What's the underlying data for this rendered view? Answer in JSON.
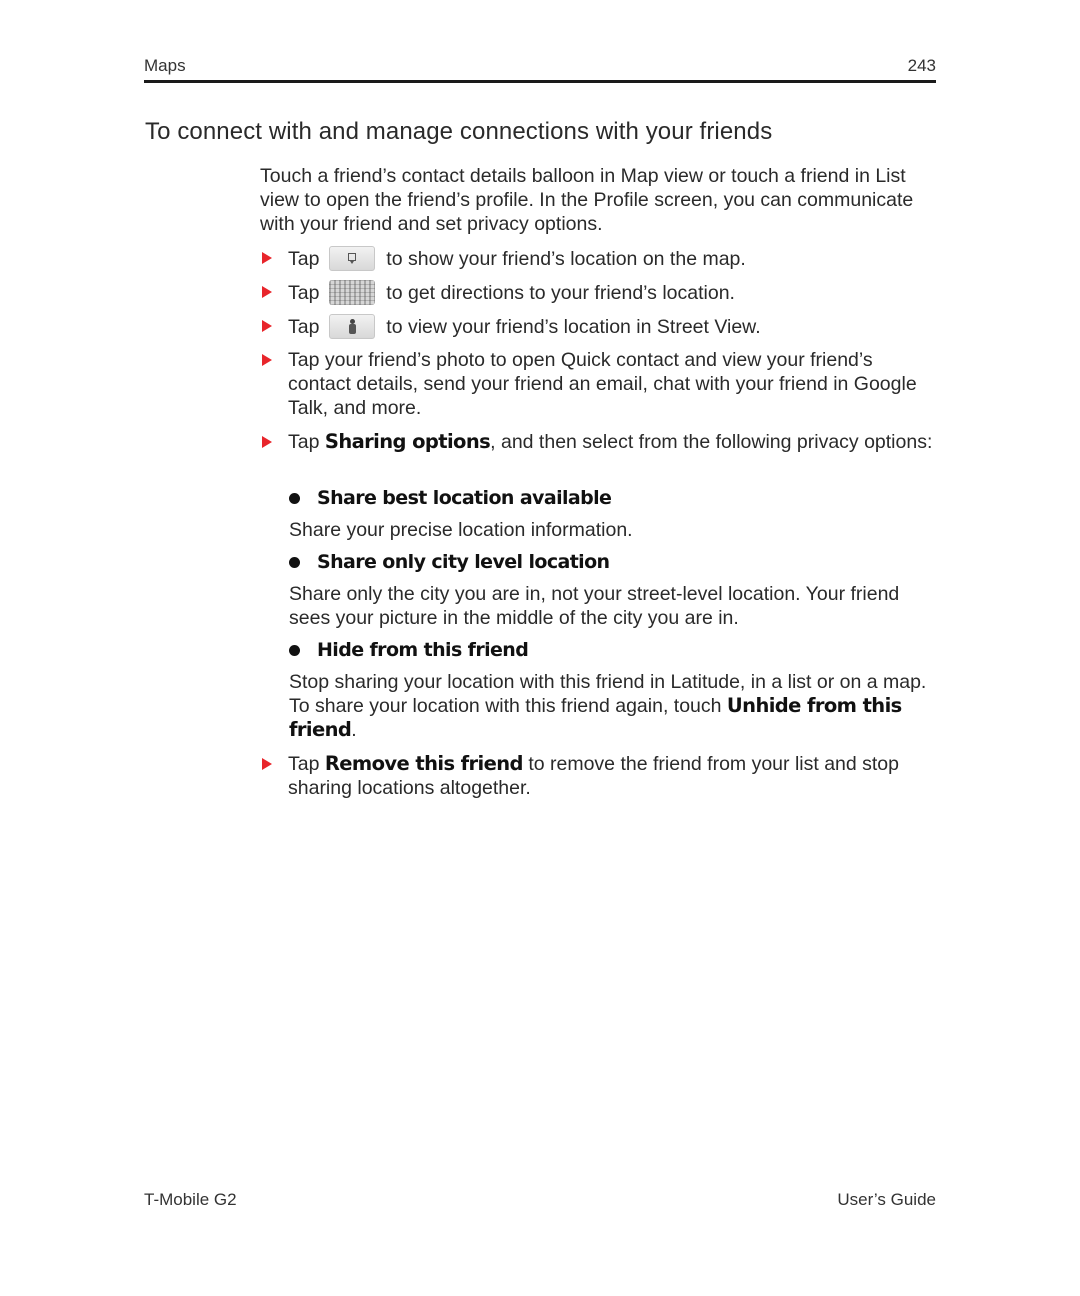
{
  "header": {
    "chapter": "Maps",
    "page_number": "243"
  },
  "section": {
    "title": "To connect with and manage connections with your friends",
    "intro": "Touch a friend’s contact details balloon in Map view or touch a friend in List view to open the friend’s profile. In the Profile screen, you can communicate with your friend and set privacy options."
  },
  "steps": [
    {
      "prefix": "Tap",
      "icon": "map-pin-icon",
      "text": "to show your friend’s location on the map."
    },
    {
      "prefix": "Tap",
      "icon": "directions-icon",
      "text": "to get directions to your friend’s location."
    },
    {
      "prefix": "Tap",
      "icon": "street-view-person-icon",
      "text": "to view your friend’s location in Street View."
    },
    {
      "text": "Tap your friend’s photo to open Quick contact and view your friend’s contact details, send your friend an email, chat with your friend in Google Talk, and more."
    },
    {
      "prefix": "Tap",
      "bold": "Sharing options",
      "text": ", and then select from the following privacy options:"
    },
    {
      "prefix": "Tap",
      "bold": "Remove this friend",
      "text": "to remove the friend from your list and stop sharing locations altogether."
    }
  ],
  "privacy_options": [
    {
      "label": "Share best location available",
      "description": "Share your precise location information."
    },
    {
      "label": "Share only city level location",
      "description": "Share only the city you are in, not your street-level location. Your friend sees your picture in the middle of the city you are in."
    },
    {
      "label": "Hide from this friend",
      "description": "Stop sharing your location with this friend in Latitude, in a list or on a map. To share your location with this friend again, touch",
      "description_bold": "Unhide from this friend",
      "description_end": "."
    }
  ],
  "footer": {
    "product": "T-Mobile G2",
    "guide": "User’s Guide"
  },
  "colors": {
    "bullet_accent": "#e8252b",
    "rule": "#1a1a1a"
  }
}
